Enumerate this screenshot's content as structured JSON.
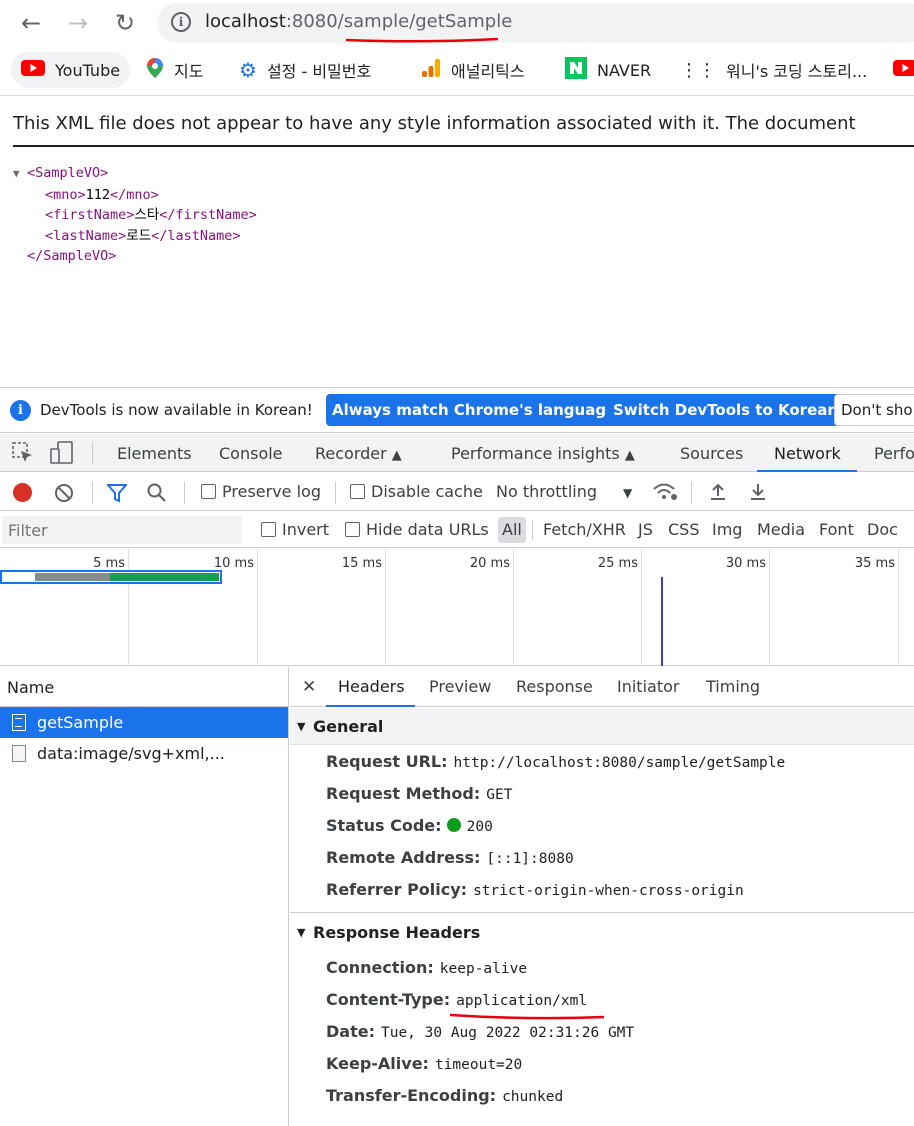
{
  "browser": {
    "url_host": "localhost",
    "url_rest": ":8080/sample/getSample",
    "bookmarks": [
      {
        "icon": "youtube-icon",
        "label": "YouTube"
      },
      {
        "icon": "maps-pin-icon",
        "label": "지도"
      },
      {
        "icon": "gear-icon",
        "label": "설정 - 비밀번호"
      },
      {
        "icon": "analytics-icon",
        "label": "애널리틱스"
      },
      {
        "icon": "naver-icon",
        "label": "NAVER"
      },
      {
        "icon": "dots-icon",
        "label": "워니's 코딩 스토리..."
      }
    ]
  },
  "page": {
    "notice": "This XML file does not appear to have any style information associated with it. The document",
    "xml": {
      "root_open": "<SampleVO>",
      "mno_open": "<mno>",
      "mno_value": "112",
      "mno_close": "</mno>",
      "first_open": "<firstName>",
      "first_value": "스타",
      "first_close": "</firstName>",
      "last_open": "<lastName>",
      "last_value": "로드",
      "last_close": "</lastName>",
      "root_close": "</SampleVO>"
    }
  },
  "devtools": {
    "infobar": {
      "message": "DevTools is now available in Korean!",
      "btn_match": "Always match Chrome's language",
      "btn_switch": "Switch DevTools to Korean",
      "btn_dont": "Don't sho"
    },
    "panel_tabs": [
      "Elements",
      "Console",
      "Recorder",
      "Performance insights",
      "Sources",
      "Network",
      "Perfo"
    ],
    "toolbar": {
      "preserve_log": "Preserve log",
      "disable_cache": "Disable cache",
      "throttling": "No throttling"
    },
    "filter": {
      "placeholder": "Filter",
      "invert": "Invert",
      "hide_data_urls": "Hide data URLs",
      "types": [
        "All",
        "Fetch/XHR",
        "JS",
        "CSS",
        "Img",
        "Media",
        "Font",
        "Doc"
      ]
    },
    "timeline_ticks": [
      "5 ms",
      "10 ms",
      "15 ms",
      "20 ms",
      "25 ms",
      "30 ms",
      "35 ms"
    ],
    "name_header": "Name",
    "requests": [
      "getSample",
      "data:image/svg+xml,..."
    ],
    "detail_tabs": [
      "Headers",
      "Preview",
      "Response",
      "Initiator",
      "Timing"
    ],
    "general": {
      "title": "General",
      "rows": [
        {
          "key": "Request URL:",
          "value": "http://localhost:8080/sample/getSample"
        },
        {
          "key": "Request Method:",
          "value": "GET"
        },
        {
          "key": "Status Code:",
          "value": "200"
        },
        {
          "key": "Remote Address:",
          "value": "[::1]:8080"
        },
        {
          "key": "Referrer Policy:",
          "value": "strict-origin-when-cross-origin"
        }
      ]
    },
    "response_headers": {
      "title": "Response Headers",
      "rows": [
        {
          "key": "Connection:",
          "value": "keep-alive"
        },
        {
          "key": "Content-Type:",
          "value": "application/xml"
        },
        {
          "key": "Date:",
          "value": "Tue, 30 Aug 2022 02:31:26 GMT"
        },
        {
          "key": "Keep-Alive:",
          "value": "timeout=20"
        },
        {
          "key": "Transfer-Encoding:",
          "value": "chunked"
        }
      ]
    }
  },
  "colors": {
    "accent": "#1a73e8",
    "annotation_red": "#e8000b",
    "xml_tag": "#881280",
    "status_green": "#0d9d1e"
  }
}
